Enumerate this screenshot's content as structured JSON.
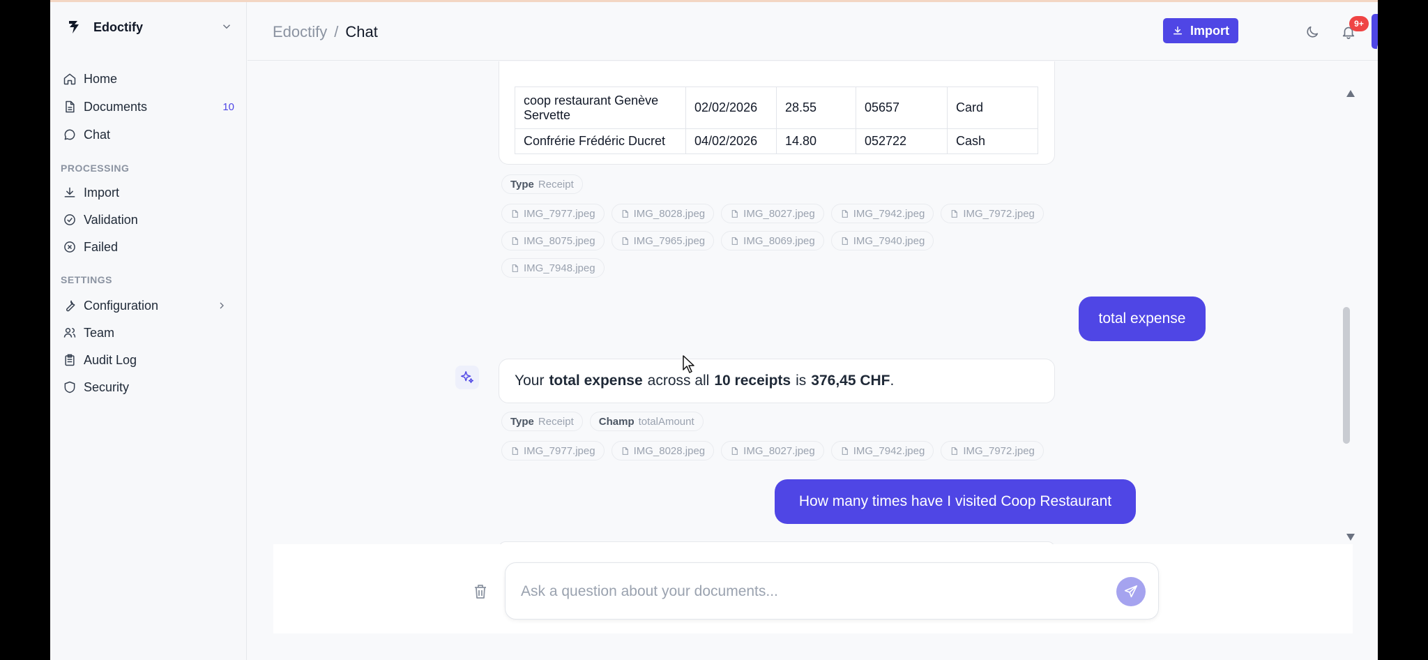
{
  "app": {
    "name": "Edoctify"
  },
  "sidebar": {
    "main_items": [
      {
        "label": "Home",
        "icon": "home-icon"
      },
      {
        "label": "Documents",
        "icon": "document-icon",
        "count": "10"
      },
      {
        "label": "Chat",
        "icon": "chat-icon"
      }
    ],
    "processing_label": "PROCESSING",
    "processing_items": [
      {
        "label": "Import",
        "icon": "download-icon"
      },
      {
        "label": "Validation",
        "icon": "check-circle-icon"
      },
      {
        "label": "Failed",
        "icon": "x-circle-icon"
      }
    ],
    "settings_label": "SETTINGS",
    "settings_items": [
      {
        "label": "Configuration",
        "icon": "wrench-icon"
      },
      {
        "label": "Team",
        "icon": "users-icon"
      },
      {
        "label": "Audit Log",
        "icon": "clipboard-icon"
      },
      {
        "label": "Security",
        "icon": "shield-icon"
      }
    ]
  },
  "header": {
    "breadcrumb": [
      "Edoctify",
      "Chat"
    ],
    "breadcrumb_sep": "/",
    "import_label": "Import",
    "notification_badge": "9+"
  },
  "chat": {
    "table": {
      "rows": [
        [
          "coop restaurant Genève Servette",
          "02/02/2026",
          "28.55",
          "05657",
          "Card"
        ],
        [
          "Confrérie Frédéric Ducret",
          "04/02/2026",
          "14.80",
          "052722",
          "Cash"
        ]
      ]
    },
    "first_response_tags": [
      {
        "key": "Type",
        "value": "Receipt"
      }
    ],
    "first_response_files": [
      [
        "IMG_7977.jpeg",
        "IMG_8028.jpeg",
        "IMG_8027.jpeg",
        "IMG_7942.jpeg",
        "IMG_7972.jpeg"
      ],
      [
        "IMG_8075.jpeg",
        "IMG_7965.jpeg",
        "IMG_8069.jpeg",
        "IMG_7940.jpeg"
      ],
      [
        "IMG_7948.jpeg"
      ]
    ],
    "user_message_1": "total expense",
    "bot_message": {
      "prefix": "Your",
      "bold1": "total expense",
      "middle": "across all",
      "bold2": "10 receipts",
      "is_word": "is",
      "bold3": "376,45 CHF",
      "suffix": "."
    },
    "second_response_tags": [
      {
        "key": "Type",
        "value": "Receipt"
      },
      {
        "key": "Champ",
        "value": "totalAmount"
      }
    ],
    "second_response_files": [
      "IMG_7977.jpeg",
      "IMG_8028.jpeg",
      "IMG_8027.jpeg",
      "IMG_7942.jpeg",
      "IMG_7972.jpeg"
    ],
    "user_message_2": "How many times have I visited Coop Restaurant"
  },
  "input": {
    "placeholder": "Ask a question about your documents..."
  },
  "colors": {
    "accent": "#4f46e5",
    "badge": "#ef4444",
    "send_disabled": "#a5a3ef"
  }
}
